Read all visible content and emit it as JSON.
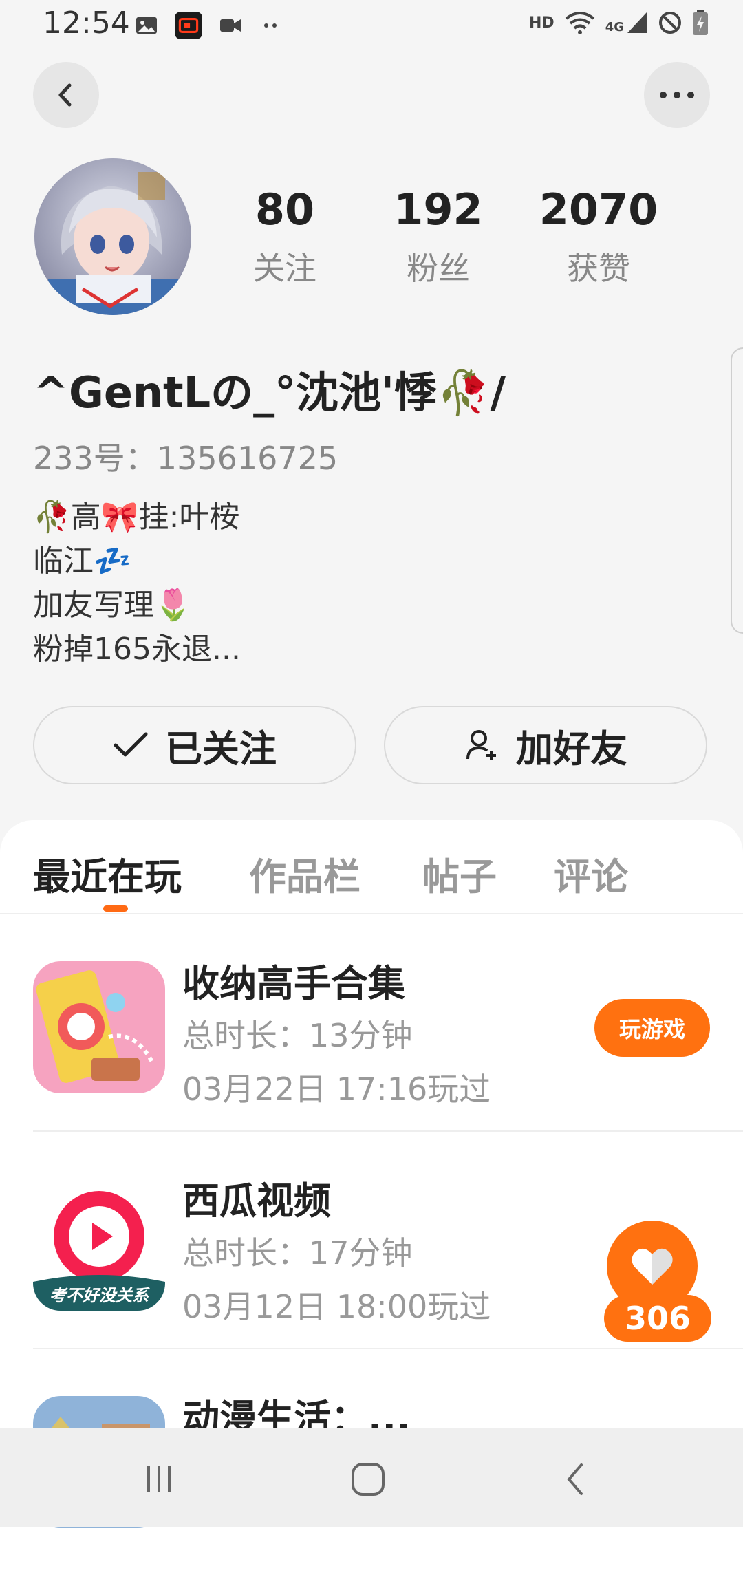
{
  "status_bar": {
    "time": "12:54",
    "left_icons": [
      "image-icon",
      "screen-record-icon",
      "video-camera-icon",
      "more-dots-icon"
    ],
    "right_icons": [
      "hd-icon",
      "wifi-icon",
      "4g-signal-icon",
      "do-not-disturb-icon",
      "battery-icon"
    ],
    "hd_label": "HD",
    "network_label": "4G"
  },
  "header": {
    "back_icon": "chevron-left-icon",
    "more_icon": "more-horizontal-icon"
  },
  "profile": {
    "nickname": "^GentLの_°沈池'悸🥀/",
    "uid_line": "233号：135616725",
    "bio_lines": [
      "🥀高🎀挂:叶桉",
      "临江💤",
      "加友写理🌷",
      "粉掉165永退..."
    ],
    "stats": [
      {
        "value": "80",
        "label": "关注"
      },
      {
        "value": "192",
        "label": "粉丝"
      },
      {
        "value": "2070",
        "label": "获赞"
      }
    ]
  },
  "actions": {
    "follow_label": "已关注",
    "add_friend_label": "加好友"
  },
  "tabs": [
    {
      "label": "最近在玩",
      "active": true
    },
    {
      "label": "作品栏",
      "active": false
    },
    {
      "label": "帖子",
      "active": false
    },
    {
      "label": "评论",
      "active": false
    }
  ],
  "games": [
    {
      "title": "收纳高手合集",
      "duration": "总时长：13分钟",
      "last_played": "03月22日 17:16玩过",
      "button": "玩游戏"
    },
    {
      "title": "西瓜视频",
      "duration": "总时长：17分钟",
      "last_played": "03月12日 18:00玩过",
      "icon_caption": "考不好没关系"
    },
    {
      "title": "动漫生活：..."
    }
  ],
  "like_float": {
    "count": "306",
    "icon": "heart-icon"
  },
  "nav_bar": {
    "icons": [
      "recent-apps-icon",
      "home-icon",
      "back-icon"
    ]
  },
  "colors": {
    "accent": "#ff7110",
    "background": "#f5f5f5",
    "text_primary": "#222222",
    "text_secondary": "#999999"
  }
}
